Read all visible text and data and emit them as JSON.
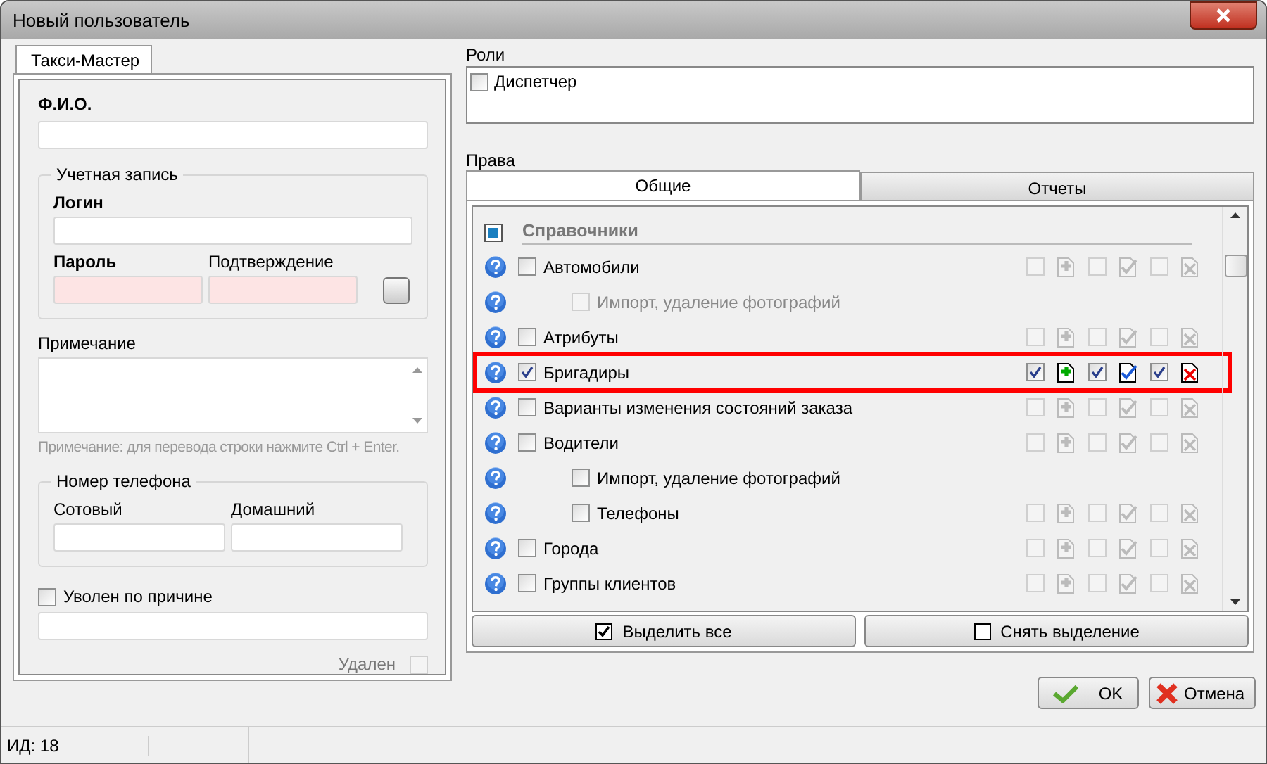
{
  "window": {
    "title": "Новый пользователь"
  },
  "left_tab": {
    "label": "Такси-Мастер",
    "selected": true
  },
  "full_name": {
    "label": "Ф.И.О."
  },
  "account": {
    "legend": "Учетная запись",
    "login_label": "Логин",
    "password": {
      "label": "Пароль",
      "invalid": true
    },
    "confirm": {
      "label": "Подтверждение",
      "invalid": true
    }
  },
  "note": {
    "label": "Примечание",
    "hint": "Примечание: для перевода строки нажмите Ctrl + Enter."
  },
  "phone": {
    "legend": "Номер телефона",
    "mobile_label": "Сотовый",
    "home_label": "Домашний"
  },
  "fired": {
    "label": "Уволен по причине",
    "checked": false
  },
  "deleted": {
    "label": "Удален",
    "checked": false
  },
  "roles": {
    "label": "Роли",
    "items": [
      {
        "label": "Диспетчер",
        "checked": false
      }
    ]
  },
  "rights": {
    "label": "Права",
    "tabs": [
      {
        "label": "Общие",
        "selected": true
      },
      {
        "label": "Отчеты",
        "selected": false
      }
    ],
    "section": {
      "label": "Справочники",
      "partial": true
    },
    "rows": [
      {
        "label": "Автомобили",
        "checked": false,
        "perms": [
          {
            "kind": "add",
            "checked": false,
            "disabled": true
          },
          {
            "kind": "edit",
            "checked": false,
            "disabled": true
          },
          {
            "kind": "delete",
            "checked": false,
            "disabled": true
          }
        ],
        "children": [
          {
            "label": "Импорт, удаление фотографий",
            "checked": false,
            "disabled": true
          }
        ]
      },
      {
        "label": "Атрибуты",
        "checked": false,
        "perms": [
          {
            "kind": "add",
            "checked": false,
            "disabled": true
          },
          {
            "kind": "edit",
            "checked": false,
            "disabled": true
          },
          {
            "kind": "delete",
            "checked": false,
            "disabled": true
          }
        ]
      },
      {
        "label": "Бригадиры",
        "checked": true,
        "highlighted": true,
        "perms": [
          {
            "kind": "add",
            "checked": true,
            "disabled": false
          },
          {
            "kind": "edit",
            "checked": true,
            "disabled": false
          },
          {
            "kind": "delete",
            "checked": true,
            "disabled": false
          }
        ]
      },
      {
        "label": "Варианты изменения состояний заказа",
        "checked": false,
        "perms": [
          {
            "kind": "add",
            "checked": false,
            "disabled": true
          },
          {
            "kind": "edit",
            "checked": false,
            "disabled": true
          },
          {
            "kind": "delete",
            "checked": false,
            "disabled": true
          }
        ]
      },
      {
        "label": "Водители",
        "checked": false,
        "perms": [
          {
            "kind": "add",
            "checked": false,
            "disabled": true
          },
          {
            "kind": "edit",
            "checked": false,
            "disabled": true
          },
          {
            "kind": "delete",
            "checked": false,
            "disabled": true
          }
        ],
        "children": [
          {
            "label": "Импорт, удаление фотографий",
            "checked": false,
            "disabled": false
          },
          {
            "label": "Телефоны",
            "checked": false,
            "perms": [
              {
                "kind": "add",
                "checked": false,
                "disabled": true
              },
              {
                "kind": "edit",
                "checked": false,
                "disabled": true
              },
              {
                "kind": "delete",
                "checked": false,
                "disabled": true
              }
            ]
          }
        ]
      },
      {
        "label": "Города",
        "checked": false,
        "perms": [
          {
            "kind": "add",
            "checked": false,
            "disabled": true
          },
          {
            "kind": "edit",
            "checked": false,
            "disabled": true
          },
          {
            "kind": "delete",
            "checked": false,
            "disabled": true
          }
        ]
      },
      {
        "label": "Группы клиентов",
        "checked": false,
        "perms": [
          {
            "kind": "add",
            "checked": false,
            "disabled": true
          },
          {
            "kind": "edit",
            "checked": false,
            "disabled": true
          },
          {
            "kind": "delete",
            "checked": false,
            "disabled": true
          }
        ]
      }
    ],
    "buttons": [
      {
        "label": "Выделить все",
        "kind": "check"
      },
      {
        "label": "Снять выделение",
        "kind": "uncheck"
      }
    ]
  },
  "buttons": [
    {
      "label": "OK",
      "kind": "ok"
    },
    {
      "label": "Отмена",
      "kind": "cancel"
    }
  ],
  "status_bar": {
    "id": "ИД: 18"
  }
}
